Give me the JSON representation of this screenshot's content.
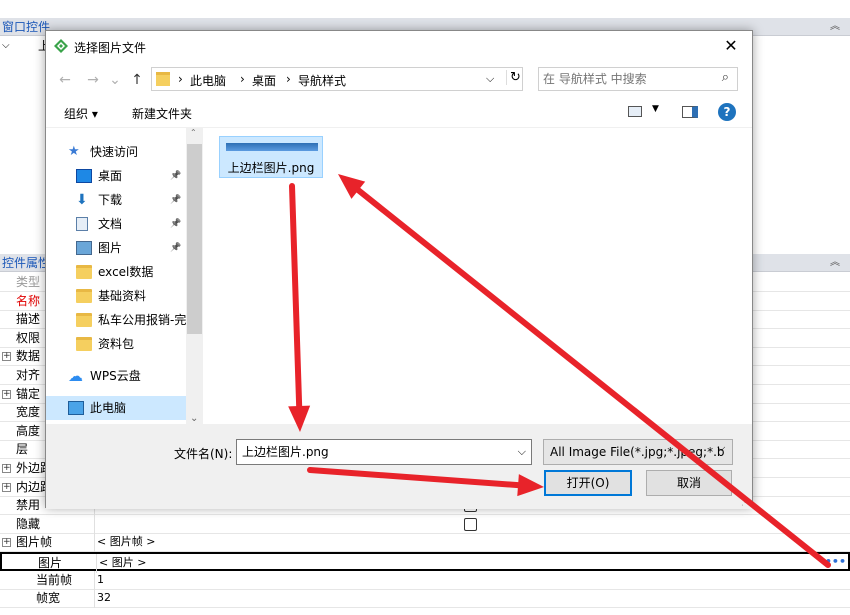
{
  "background": {
    "window_controls_header": "窗口控件",
    "tree_item": "上",
    "properties_header": "控件属性",
    "prop_rows": [
      {
        "name": "类型",
        "value": "",
        "color": "#999999",
        "expandable": false
      },
      {
        "name": "名称",
        "value": "",
        "color": "#e00000",
        "expandable": false
      },
      {
        "name": "描述",
        "value": "",
        "color": "#000000",
        "expandable": false
      },
      {
        "name": "权限",
        "value": "",
        "color": "#000000",
        "expandable": false
      },
      {
        "name": "数据",
        "value": "",
        "color": "#000000",
        "expandable": true
      },
      {
        "name": "对齐",
        "value": "",
        "color": "#000000",
        "expandable": false
      },
      {
        "name": "锚定",
        "value": "",
        "color": "#000000",
        "expandable": true
      },
      {
        "name": "宽度",
        "value": "",
        "color": "#000000",
        "expandable": false
      },
      {
        "name": "高度",
        "value": "",
        "color": "#000000",
        "expandable": false
      },
      {
        "name": "层",
        "value": "",
        "color": "#000000",
        "expandable": false
      },
      {
        "name": "外边距",
        "value": "",
        "color": "#000000",
        "expandable": true
      },
      {
        "name": "内边距",
        "value": "",
        "color": "#000000",
        "expandable": true
      },
      {
        "name": "禁用",
        "value": "",
        "color": "#000000",
        "expandable": false,
        "checkbox": true
      },
      {
        "name": "隐藏",
        "value": "",
        "color": "#000000",
        "expandable": false,
        "checkbox": true
      },
      {
        "name": "图片帧",
        "value": "< 图片帧 >",
        "color": "#000000",
        "expandable": true
      },
      {
        "name": "图片",
        "value": "< 图片 >",
        "color": "#000000",
        "expandable": false,
        "indent": true,
        "selected": true
      },
      {
        "name": "当前帧",
        "value": "1",
        "color": "#000000",
        "expandable": false,
        "indent": true
      },
      {
        "name": "帧宽",
        "value": "32",
        "color": "#000000",
        "expandable": false,
        "indent": true
      }
    ],
    "ellipsis": "•••"
  },
  "dialog": {
    "title": "选择图片文件",
    "close": "✕",
    "address": [
      "此电脑",
      "桌面",
      "导航样式"
    ],
    "search_placeholder": "在 导航样式 中搜索",
    "organize": "组织 ▾",
    "new_folder": "新建文件夹",
    "nav_items": [
      {
        "label": "快速访问",
        "icon": "star-icon",
        "pin": false,
        "indent": 0
      },
      {
        "label": "桌面",
        "icon": "desktop-icon",
        "pin": true,
        "indent": 1
      },
      {
        "label": "下载",
        "icon": "download-icon",
        "pin": true,
        "indent": 1
      },
      {
        "label": "文档",
        "icon": "document-icon",
        "pin": true,
        "indent": 1
      },
      {
        "label": "图片",
        "icon": "picture-icon",
        "pin": true,
        "indent": 1
      },
      {
        "label": "excel数据",
        "icon": "folder-icon",
        "pin": false,
        "indent": 1
      },
      {
        "label": "基础资料",
        "icon": "folder-icon",
        "pin": false,
        "indent": 1
      },
      {
        "label": "私车公用报销-完",
        "icon": "folder-icon",
        "pin": false,
        "indent": 1
      },
      {
        "label": "资料包",
        "icon": "folder-icon",
        "pin": false,
        "indent": 1
      },
      {
        "label": "WPS云盘",
        "icon": "cloud-icon",
        "pin": false,
        "indent": 0
      },
      {
        "label": "此电脑",
        "icon": "computer-icon",
        "pin": false,
        "indent": 0,
        "selected": true
      }
    ],
    "file": {
      "name": "上边栏图片.png"
    },
    "filename_label": "文件名(N):",
    "filename_value": "上边栏图片.png",
    "filter": "All Image File(*.jpg;*.jpeg;*.b",
    "open_button": "打开(O)",
    "cancel_button": "取消"
  },
  "colors": {
    "arrow": "#e8232a",
    "selection": "#cce8ff",
    "accent": "#0078d7"
  }
}
